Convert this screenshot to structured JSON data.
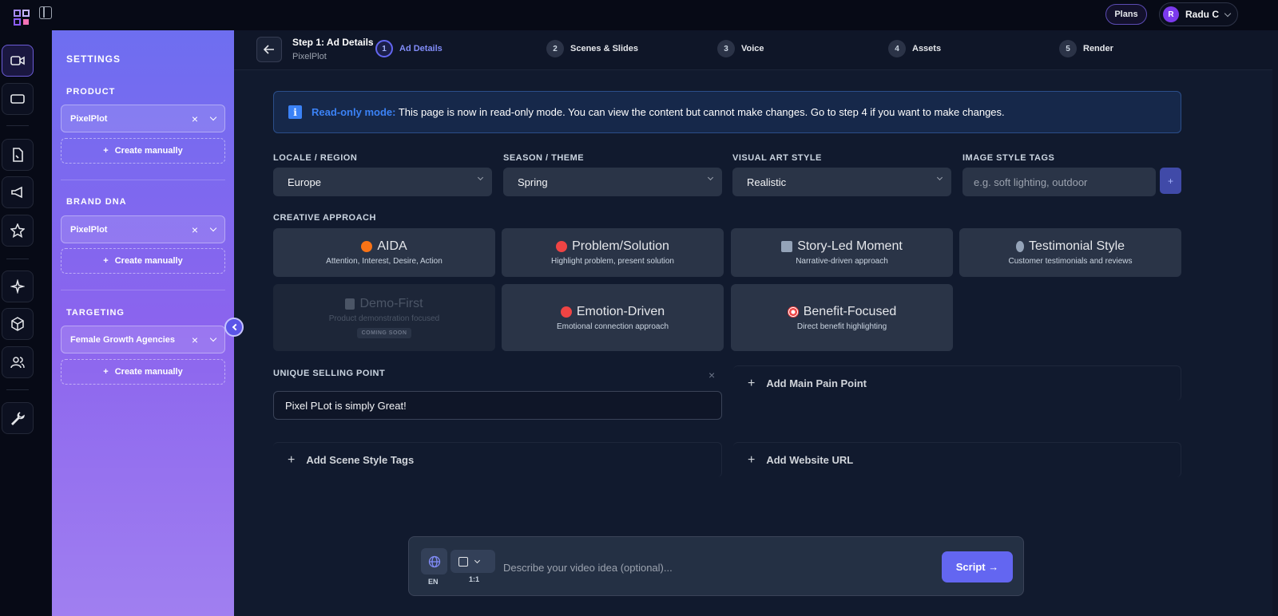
{
  "topbar": {
    "plans_label": "Plans",
    "user": {
      "initial": "R",
      "name": "Radu C"
    }
  },
  "rail": {
    "items": [
      "video-icon",
      "screen-icon",
      "document-icon",
      "megaphone-icon",
      "star-icon",
      "sparkle-icon",
      "box-icon",
      "users-icon",
      "wrench-icon"
    ]
  },
  "settings": {
    "title": "SETTINGS",
    "product": {
      "title": "PRODUCT",
      "value": "PixelPlot",
      "create_label": "Create manually"
    },
    "brand_dna": {
      "title": "BRAND DNA",
      "value": "PixelPlot",
      "create_label": "Create manually"
    },
    "targeting": {
      "title": "TARGETING",
      "value": "Female Growth Agencies",
      "create_label": "Create manually"
    }
  },
  "stepper": {
    "title": "Step 1: Ad Details",
    "subtitle": "PixelPlot",
    "steps": [
      {
        "num": "1",
        "label": "Ad Details"
      },
      {
        "num": "2",
        "label": "Scenes & Slides"
      },
      {
        "num": "3",
        "label": "Voice"
      },
      {
        "num": "4",
        "label": "Assets"
      },
      {
        "num": "5",
        "label": "Render"
      }
    ]
  },
  "notice": {
    "icon": "i",
    "label": "Read-only mode:",
    "text": "This page is now in read-only mode. You can view the content but cannot make changes. Go to step 4 if you want to make changes."
  },
  "fields": {
    "locale": {
      "label": "LOCALE / REGION",
      "value": "Europe"
    },
    "season": {
      "label": "SEASON / THEME",
      "value": "Spring"
    },
    "art_style": {
      "label": "VISUAL ART STYLE",
      "value": "Realistic"
    },
    "image_tags": {
      "label": "IMAGE STYLE TAGS",
      "placeholder": "e.g. soft lighting, outdoor",
      "add_label": "+"
    }
  },
  "creative": {
    "label": "CREATIVE APPROACH",
    "cards": [
      {
        "title": "AIDA",
        "desc": "Attention, Interest, Desire, Action",
        "icon": "fire-icon",
        "color": "#f97316"
      },
      {
        "title": "Problem/Solution",
        "desc": "Highlight problem, present solution",
        "icon": "face-icon",
        "color": "#ef4444"
      },
      {
        "title": "Story-Led Moment",
        "desc": "Narrative-driven approach",
        "icon": "book-icon",
        "color": "#94a3b8"
      },
      {
        "title": "Testimonial Style",
        "desc": "Customer testimonials and reviews",
        "icon": "mic-icon",
        "color": "#94a3b8"
      },
      {
        "title": "Demo-First",
        "desc": "Product demonstration focused",
        "icon": "clipboard-icon",
        "color": "#4b5566",
        "badge": "COMING SOON"
      },
      {
        "title": "Emotion-Driven",
        "desc": "Emotional connection approach",
        "icon": "heart-icon",
        "color": "#ef4444"
      },
      {
        "title": "Benefit-Focused",
        "desc": "Direct benefit highlighting",
        "icon": "target-icon",
        "color": "#ef4444"
      }
    ]
  },
  "usp": {
    "label": "UNIQUE SELLING POINT",
    "value": "Pixel PLot is simply Great!",
    "close": "×"
  },
  "add_rows": {
    "pain_point": "Add Main Pain Point",
    "scene_tags": "Add Scene Style Tags",
    "website": "Add Website URL"
  },
  "prompt": {
    "lang": "EN",
    "ratio": "1:1",
    "placeholder": "Describe your video idea (optional)...",
    "submit_label": "Script →"
  }
}
